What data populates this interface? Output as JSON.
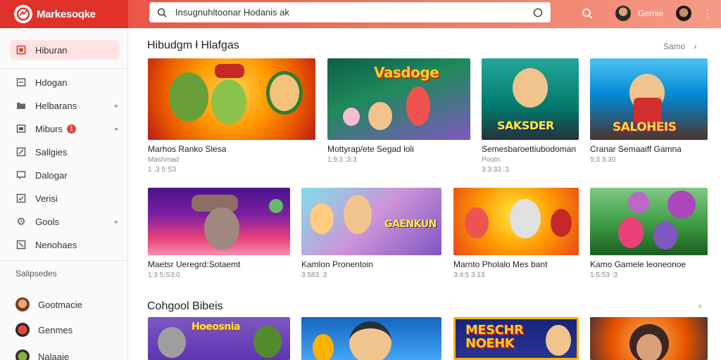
{
  "app": {
    "name": "Markesoqke"
  },
  "search": {
    "query": "Insugnuhltoonar Hodanis ak"
  },
  "header": {
    "user_name": "Gernie"
  },
  "sidebar": {
    "items": [
      {
        "label": "Hiburan",
        "icon": "home-icon"
      },
      {
        "label": "Hdogan",
        "icon": "list-icon"
      },
      {
        "label": "Helbarans",
        "icon": "folder-icon"
      },
      {
        "label": "Miburs",
        "icon": "grid-icon",
        "badge": "1"
      },
      {
        "label": "Sallgies",
        "icon": "edit-icon"
      },
      {
        "label": "Dalogar",
        "icon": "chat-icon"
      },
      {
        "label": "Verisi",
        "icon": "check-icon"
      },
      {
        "label": "Gools",
        "icon": "gear-icon"
      },
      {
        "label": "Nenohaes",
        "icon": "close-box-icon"
      }
    ],
    "section_label": "Salipsedes",
    "subscriptions": [
      {
        "label": "Gootmacie"
      },
      {
        "label": "Genmes"
      },
      {
        "label": "Nalaaie"
      }
    ]
  },
  "sections": [
    {
      "title": "Hibudgm ł Hlafgas",
      "action": "Samo",
      "cards": [
        {
          "title": "Marhos Ranko Slesa",
          "sub": "Mashmad",
          "meta": "1 :3 5:S3",
          "label": ""
        },
        {
          "title": "Mottyrap/ete Segad loli",
          "sub": "",
          "meta": "1:9:3 :3:3",
          "label": "Vasdoge"
        },
        {
          "title": "Semesbaroettiubodoman",
          "sub": "Pootn",
          "meta": "3:3:33 :3",
          "label": "SAKSDER"
        },
        {
          "title": "Cranar Semaaiff Gamna",
          "sub": "",
          "meta": "5:3 3:30",
          "label": "SALOHEIS"
        },
        {
          "title": "Maetsr Ueregrd:Sotaemt",
          "sub": "",
          "meta": "1:3 5:S3:0",
          "label": ""
        },
        {
          "title": "Kamlon Pronentoin",
          "sub": "",
          "meta": "3:583 :3",
          "label": "GAENKUN"
        },
        {
          "title": "Marnto Pholalo Mes bant",
          "sub": "",
          "meta": "3:4:5 3 13",
          "label": ""
        },
        {
          "title": "Kamo Gamele leoneonoe",
          "sub": "",
          "meta": "1:5:53 :3",
          "label": ""
        }
      ]
    },
    {
      "title": "Cohgool Bibeis",
      "action": "",
      "cards": [
        {
          "label": "Hoeosnia"
        },
        {
          "label": ""
        },
        {
          "label": "MESCHR NOEHK"
        },
        {
          "label": ""
        }
      ]
    }
  ],
  "colors": {
    "accent": "#e0312b",
    "active_bg": "#fde4e2"
  }
}
